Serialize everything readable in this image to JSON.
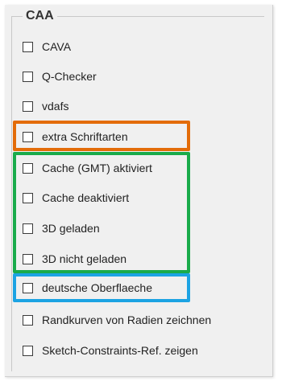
{
  "group": {
    "title": "CAA"
  },
  "options": [
    {
      "label": "CAVA",
      "checked": false
    },
    {
      "label": "Q-Checker",
      "checked": false
    },
    {
      "label": "vdafs",
      "checked": false
    },
    {
      "label": "extra Schriftarten",
      "checked": false
    },
    {
      "label": "Cache (GMT) aktiviert",
      "checked": false
    },
    {
      "label": "Cache deaktiviert",
      "checked": false
    },
    {
      "label": "3D geladen",
      "checked": false
    },
    {
      "label": "3D nicht geladen",
      "checked": false
    },
    {
      "label": "deutsche Oberflaeche",
      "checked": false
    },
    {
      "label": "Randkurven von Radien zeichnen",
      "checked": false
    },
    {
      "label": "Sketch-Constraints-Ref. zeigen",
      "checked": false
    }
  ],
  "highlights": [
    {
      "name": "orange",
      "color": "#e36c09",
      "covers": [
        "extra Schriftarten"
      ]
    },
    {
      "name": "green",
      "color": "#1aab4b",
      "covers": [
        "Cache (GMT) aktiviert",
        "Cache deaktiviert",
        "3D geladen",
        "3D nicht geladen"
      ]
    },
    {
      "name": "blue",
      "color": "#1ca3e3",
      "covers": [
        "deutsche Oberflaeche"
      ]
    }
  ]
}
